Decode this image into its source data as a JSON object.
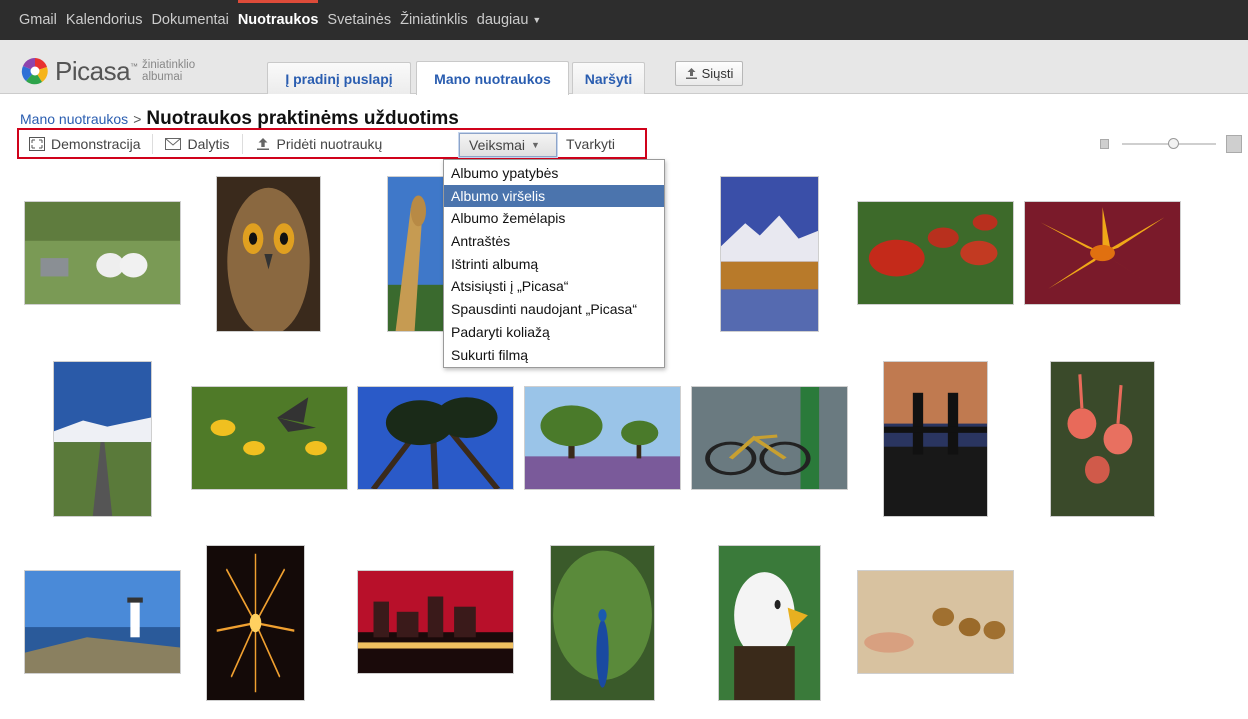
{
  "topnav": {
    "items": [
      "Gmail",
      "Kalendorius",
      "Dokumentai",
      "Nuotraukos",
      "Svetainės",
      "Žiniatinklis",
      "daugiau"
    ],
    "active": "Nuotraukos"
  },
  "logo": {
    "word": "Picasa",
    "tm": "™",
    "sub1": "žiniatinklio",
    "sub2": "albumai"
  },
  "tabs": {
    "home": "Į pradinį puslapį",
    "mine": "Mano nuotraukos",
    "browse": "Naršyti"
  },
  "upload_label": "Siųsti",
  "breadcrumb": {
    "parent": "Mano nuotraukos",
    "sep": ">",
    "album": "Nuotraukos praktinėms užduotims"
  },
  "toolbar": {
    "slideshow": "Demonstracija",
    "share": "Dalytis",
    "add": "Pridėti nuotraukų",
    "actions": "Veiksmai",
    "organize": "Tvarkyti"
  },
  "menu": {
    "items": [
      "Albumo ypatybės",
      "Albumo viršelis",
      "Albumo žemėlapis",
      "Antraštės",
      "Ištrinti albumą",
      "Atsisiųsti į „Picasa“",
      "Spausdinti naudojant „Picasa“",
      "Padaryti koliažą",
      "Sukurti filmą"
    ],
    "highlighted_index": 1
  },
  "zoom": {
    "level": 0.55
  },
  "colors": {
    "accent": "#dd4b39",
    "link": "#2a5db0",
    "highlight": "#4b74ad",
    "toolbar_outline": "#d0021b"
  },
  "photos": [
    {
      "name": "lambs",
      "icon": "photo-lambs"
    },
    {
      "name": "owl",
      "icon": "photo-owl"
    },
    {
      "name": "giraffe",
      "icon": "photo-giraffe"
    },
    {
      "name": "mountain-lake",
      "icon": "photo-mountain-lake"
    },
    {
      "name": "apples",
      "icon": "photo-apples"
    },
    {
      "name": "lily",
      "icon": "photo-lily"
    },
    {
      "name": "road",
      "icon": "photo-road"
    },
    {
      "name": "butterfly",
      "icon": "photo-butterfly"
    },
    {
      "name": "palms",
      "icon": "photo-palms"
    },
    {
      "name": "trees-lavender",
      "icon": "photo-trees-lavender"
    },
    {
      "name": "bicycle",
      "icon": "photo-bicycle"
    },
    {
      "name": "tower-bridge",
      "icon": "photo-tower-bridge"
    },
    {
      "name": "flamingos",
      "icon": "photo-flamingos"
    },
    {
      "name": "lighthouse",
      "icon": "photo-lighthouse"
    },
    {
      "name": "fireworks",
      "icon": "photo-fireworks"
    },
    {
      "name": "city-night",
      "icon": "photo-city-night"
    },
    {
      "name": "peacock",
      "icon": "photo-peacock"
    },
    {
      "name": "eagle",
      "icon": "photo-eagle"
    },
    {
      "name": "walnuts",
      "icon": "photo-walnuts"
    }
  ]
}
